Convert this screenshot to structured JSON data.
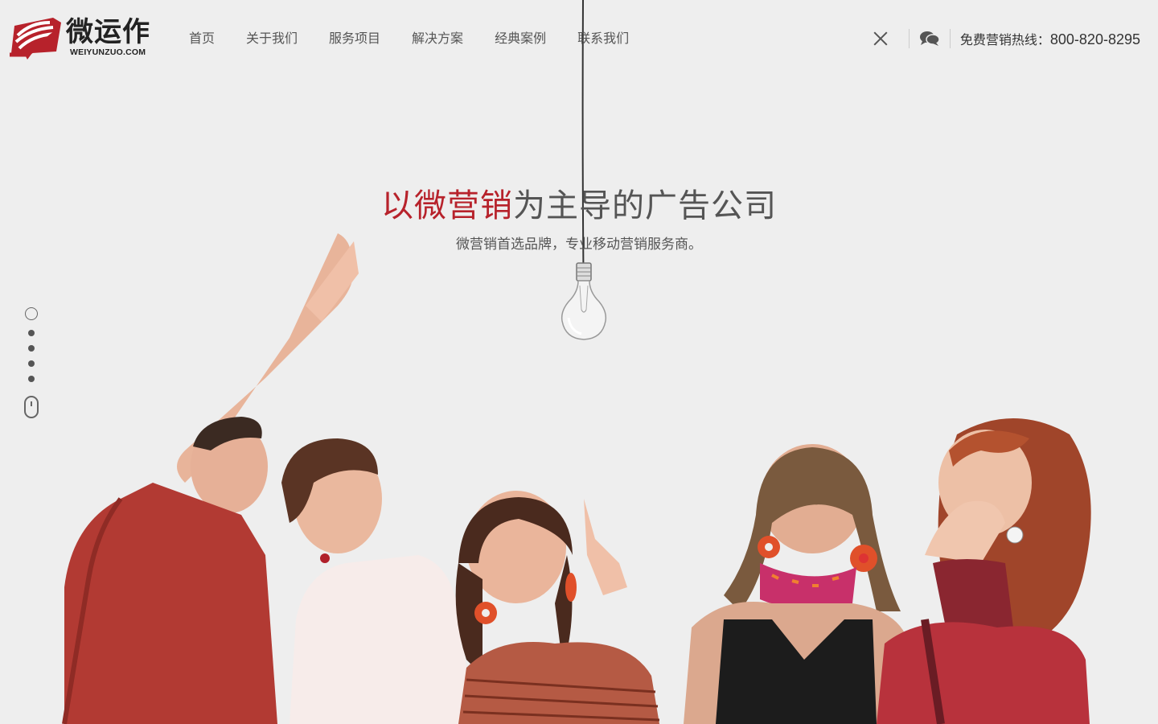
{
  "brand": {
    "name": "微运作",
    "domain": "WEIYUNZUO.COM",
    "color": "#b7222b"
  },
  "nav": {
    "items": [
      {
        "label": "首页"
      },
      {
        "label": "关于我们"
      },
      {
        "label": "服务项目"
      },
      {
        "label": "解决方案"
      },
      {
        "label": "经典案例"
      },
      {
        "label": "联系我们"
      }
    ]
  },
  "header": {
    "hotline_label": "免费营销热线：",
    "hotline_number": "800-820-8295",
    "close_icon": "close-icon",
    "chat_icon": "chat-icon"
  },
  "hero": {
    "headline_highlight": "以微营销",
    "headline_rest": "为主导的广告公司",
    "subline": "微营销首选品牌，专业移动营销服务商。",
    "highlight_color": "#b7222b"
  },
  "side_nav": {
    "slides": 5,
    "active": 1
  }
}
